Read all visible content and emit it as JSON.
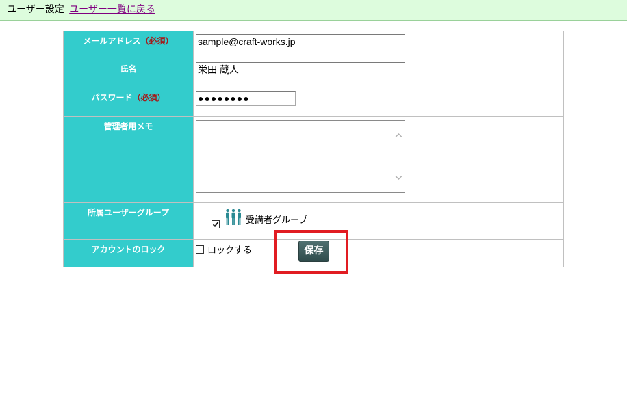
{
  "header": {
    "title": "ユーザー設定",
    "back_link": "ユーザー一覧に戻る"
  },
  "form": {
    "email": {
      "label": "メールアドレス",
      "required": "（必須）",
      "value": "sample@craft-works.jp"
    },
    "name": {
      "label": "氏名",
      "value": "栄田 蔵人"
    },
    "password": {
      "label": "パスワード",
      "required": "（必須）",
      "value": "●●●●●●●●"
    },
    "memo": {
      "label": "管理者用メモ",
      "value": ""
    },
    "group": {
      "label": "所属ユーザーグループ",
      "item_label": "受講者グループ",
      "checked": true,
      "icon": "users-group-icon"
    },
    "lock": {
      "label": "アカウントのロック",
      "checkbox_label": "ロックする",
      "checked": false
    }
  },
  "actions": {
    "save_label": "保存"
  },
  "colors": {
    "label_bg": "#33cccc",
    "required_text": "#a11c1c",
    "topbar_bg": "#ddfcdd",
    "highlight": "#e11c22",
    "save_bg": "#3a5a5a"
  }
}
